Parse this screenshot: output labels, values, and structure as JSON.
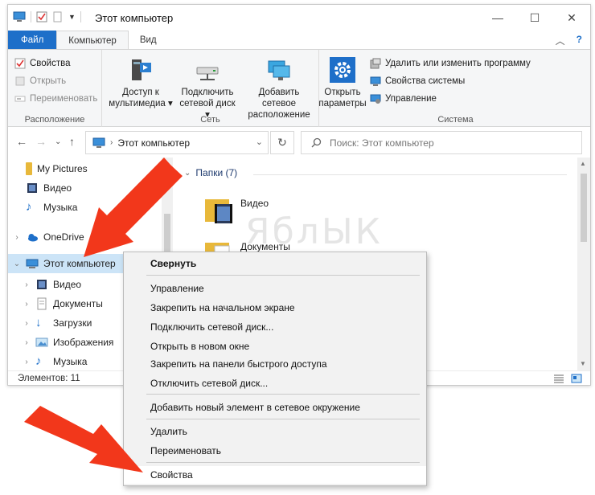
{
  "window": {
    "title": "Этот компьютер",
    "controls": {
      "minimize": "—",
      "maximize": "☐",
      "close": "✕"
    }
  },
  "ribbon_tabs": [
    {
      "label": "Файл"
    },
    {
      "label": "Компьютер"
    },
    {
      "label": "Вид"
    }
  ],
  "ribbon": {
    "location_group": {
      "label": "Расположение",
      "items": [
        "Свойства",
        "Открыть",
        "Переименовать"
      ]
    },
    "network_group": {
      "label": "Сеть",
      "media_access": {
        "line1": "Доступ к",
        "line2": "мультимедиа ▾"
      },
      "map_drive": {
        "line1": "Подключить",
        "line2": "сетевой диск ▾"
      },
      "add_location": {
        "line1": "Добавить сетевое",
        "line2": "расположение"
      }
    },
    "system_group": {
      "label": "Система",
      "open_settings": {
        "line1": "Открыть",
        "line2": "параметры"
      },
      "items": [
        "Удалить или изменить программу",
        "Свойства системы",
        "Управление"
      ]
    }
  },
  "address": {
    "path": "Этот компьютер",
    "search_placeholder": "Поиск: Этот компьютер"
  },
  "nav_pane": {
    "items": [
      {
        "label": "My Pictures"
      },
      {
        "label": "Видео"
      },
      {
        "label": "Музыка"
      },
      {
        "label": "OneDrive"
      },
      {
        "label": "Этот компьютер"
      },
      {
        "label": "Видео"
      },
      {
        "label": "Документы"
      },
      {
        "label": "Загрузки"
      },
      {
        "label": "Изображения"
      },
      {
        "label": "Музыка"
      }
    ]
  },
  "content": {
    "group_header": "Папки (7)",
    "folders": [
      {
        "label": "Видео"
      },
      {
        "label": "Документы"
      }
    ]
  },
  "status": {
    "items_count": "Элементов: 11"
  },
  "watermark": "ЯблЫК",
  "context_menu": {
    "items": [
      "Свернуть",
      "Управление",
      "Закрепить на начальном экране",
      "Подключить сетевой диск...",
      "Открыть в новом окне",
      "Закрепить на панели быстрого доступа",
      "Отключить сетевой диск...",
      "Добавить новый элемент в сетевое окружение",
      "Удалить",
      "Переименовать",
      "Свойства"
    ]
  },
  "colors": {
    "file_tab": "#1e6fc9",
    "selection": "#cce4f7",
    "arrow": "#f2371b",
    "folder": "#e8b83a"
  }
}
